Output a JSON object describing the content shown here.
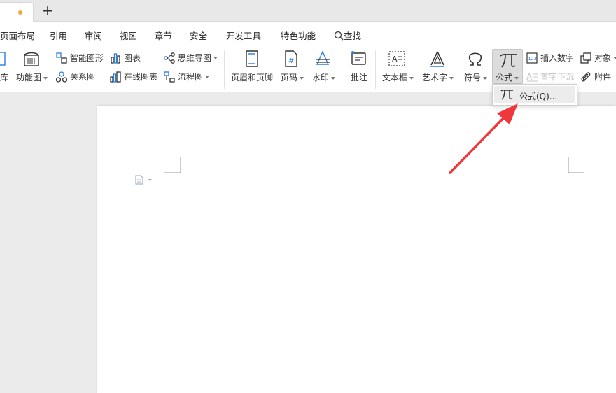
{
  "tabbar": {
    "new_tab_label": "+"
  },
  "menu": {
    "items": [
      "页面布局",
      "引用",
      "审阅",
      "视图",
      "章节",
      "安全",
      "开发工具",
      "特色功能"
    ],
    "search_label": "查找"
  },
  "ribbon": {
    "library_label": "库",
    "function_chart_label": "功能图",
    "smart_art_label": "智能图形",
    "chart_label": "图表",
    "mind_map_label": "思维导图",
    "relation_label": "关系图",
    "online_chart_label": "在线图表",
    "flowchart_label": "流程图",
    "header_footer_label": "页眉和页脚",
    "page_number_label": "页码",
    "watermark_label": "水印",
    "comment_label": "批注",
    "textbox_label": "文本框",
    "wordart_label": "艺术字",
    "symbol_label": "符号",
    "formula_label": "公式",
    "insert_number_label": "插入数字",
    "drop_cap_label": "首字下沉",
    "object_label": "对象",
    "attachment_label": "附件"
  },
  "dropdown": {
    "formula_item_label": "公式(Q)..."
  },
  "colors": {
    "accent": "#f5a33a",
    "arrow": "#f0373c"
  }
}
